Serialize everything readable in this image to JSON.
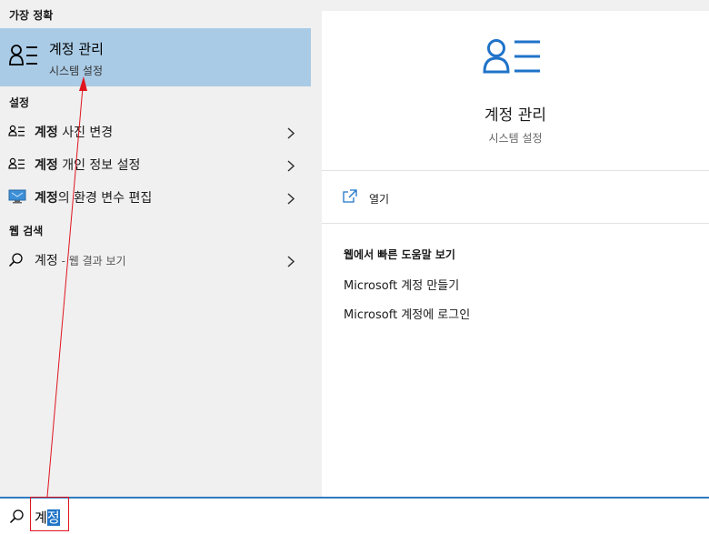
{
  "left": {
    "best_match_header": "가장 정확",
    "best_match": {
      "title": "계정 관리",
      "subtitle": "시스템 설정",
      "icon": "person-list-icon"
    },
    "settings_header": "설정",
    "settings_items": [
      {
        "bold": "계정",
        "rest": " 사진 변경",
        "icon": "person-list-icon"
      },
      {
        "bold": "계정",
        "rest": " 개인 정보 설정",
        "icon": "person-list-icon"
      },
      {
        "bold": "계정",
        "rest": "의 환경 변수 편집",
        "icon": "monitor-icon"
      }
    ],
    "web_header": "웹 검색",
    "web_item": {
      "text": "계정",
      "suffix": " - 웹 결과 보기",
      "icon": "search-icon"
    }
  },
  "right": {
    "title": "계정 관리",
    "subtitle": "시스템 설정",
    "open_label": "열기",
    "web_help_title": "웹에서 빠른 도움말 보기",
    "links": [
      "Microsoft 계정 만들기",
      "Microsoft 계정에 로그인"
    ]
  },
  "search": {
    "typed": "계",
    "selected": "정"
  },
  "colors": {
    "accent": "#1f73c8",
    "highlight": "#a9cbe6",
    "annotation": "#e0141e"
  }
}
